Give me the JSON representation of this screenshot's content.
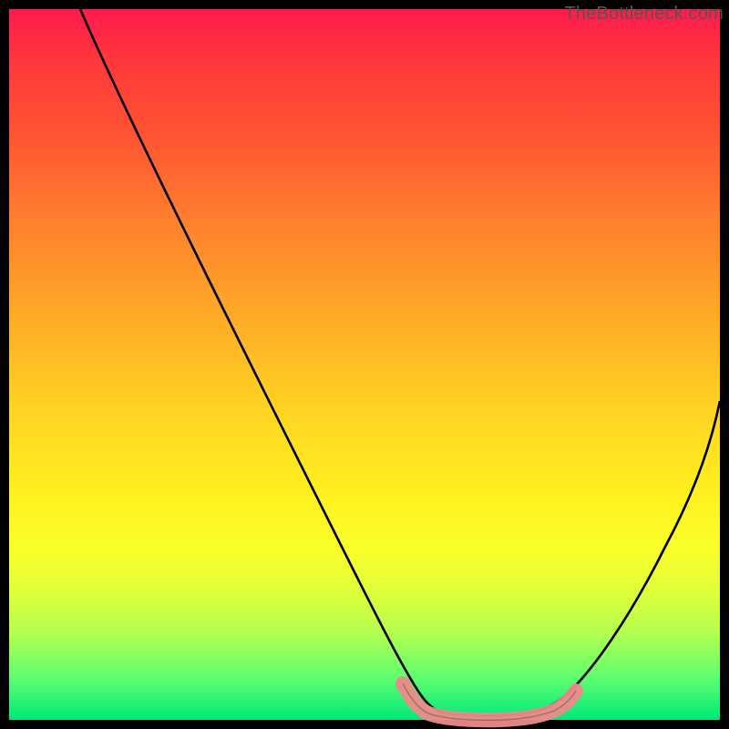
{
  "watermark": {
    "text": "TheBottleneck.com"
  },
  "chart_data": {
    "type": "line",
    "title": "",
    "xlabel": "",
    "ylabel": "",
    "xlim": [
      0,
      100
    ],
    "ylim": [
      0,
      100
    ],
    "grid": false,
    "legend": false,
    "series": [
      {
        "name": "curve",
        "x": [
          0,
          5,
          10,
          15,
          20,
          25,
          30,
          35,
          40,
          45,
          50,
          55,
          58,
          60,
          62,
          65,
          68,
          70,
          72,
          75,
          78,
          80,
          85,
          90,
          95,
          100
        ],
        "y": [
          100,
          93,
          86,
          79,
          72,
          65,
          58,
          51,
          44,
          36,
          28,
          18,
          10,
          6,
          4,
          2,
          1.5,
          1.5,
          2,
          3,
          5,
          8,
          15,
          25,
          35,
          48
        ]
      }
    ],
    "highlight": {
      "name": "pink-band",
      "color": "#ec8a8a",
      "x_range": [
        55,
        78
      ],
      "y_value_approx": 2
    },
    "colors": {
      "gradient_top": "#ff1a4d",
      "gradient_mid": "#fff01f",
      "gradient_bottom": "#00e878",
      "curve": "#000000",
      "highlight": "#ec8a8a",
      "background": "#000000"
    }
  }
}
